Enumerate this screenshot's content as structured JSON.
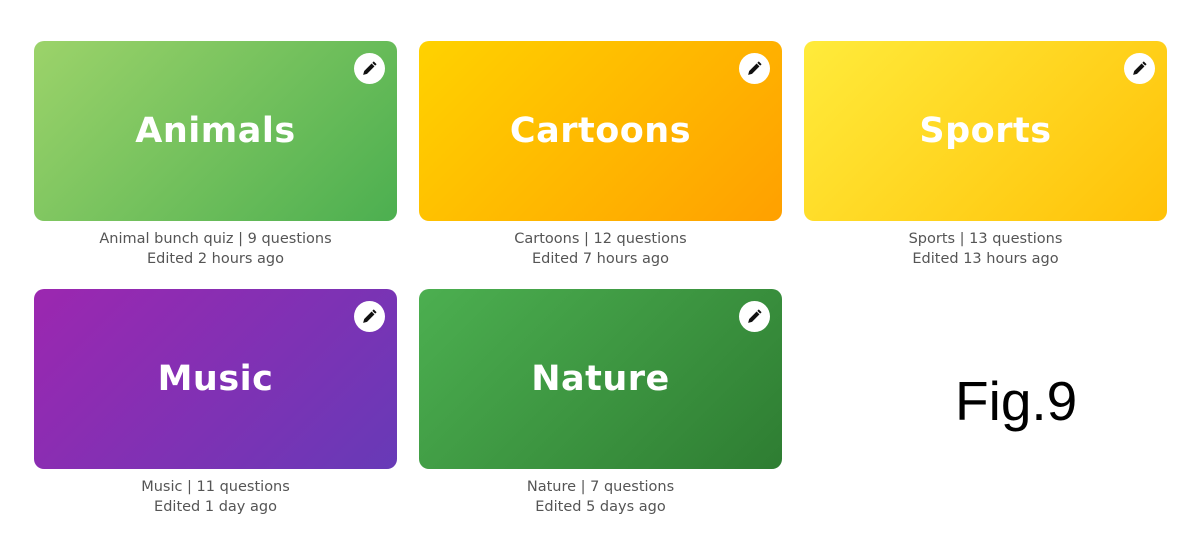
{
  "quizzes": [
    {
      "title": "Animals",
      "description": "Animal bunch quiz | 9 questions",
      "edited": "Edited 2 hours ago",
      "gradient": [
        "#9cd36a",
        "#4caf50"
      ]
    },
    {
      "title": "Cartoons",
      "description": "Cartoons | 12 questions",
      "edited": "Edited 7 hours ago",
      "gradient": [
        "#ffd200",
        "#ffa000"
      ]
    },
    {
      "title": "Sports",
      "description": "Sports | 13 questions",
      "edited": "Edited 13 hours ago",
      "gradient": [
        "#ffeb3b",
        "#ffc107"
      ]
    },
    {
      "title": "Music",
      "description": "Music | 11 questions",
      "edited": "Edited 1 day ago",
      "gradient": [
        "#9c27b0",
        "#673ab7"
      ]
    },
    {
      "title": "Nature",
      "description": "Nature | 7 questions",
      "edited": "Edited 5 days ago",
      "gradient": [
        "#4caf50",
        "#2e7d32"
      ]
    }
  ],
  "edit_icon": "pencil-icon",
  "figure_label": "Fig.9"
}
